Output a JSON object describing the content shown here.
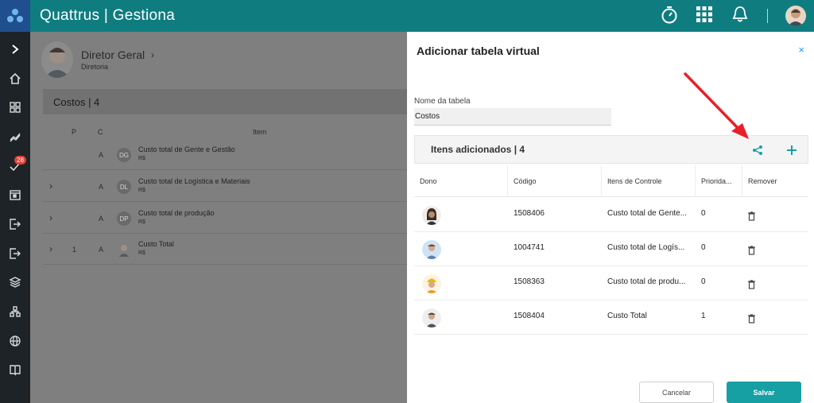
{
  "app": {
    "title": "Quattrus | Gestiona"
  },
  "topbar": {
    "icons": [
      "timer-icon",
      "apps-grid-icon",
      "bell-icon",
      "user-avatar"
    ]
  },
  "rail": {
    "items": [
      "chevron-right-icon",
      "home-icon",
      "dashboard-icon",
      "trend-icon",
      "tasks-icon",
      "calendar-icon",
      "exit-icon",
      "logout-icon",
      "layers-icon",
      "org-chart-icon",
      "globe-icon",
      "book-icon"
    ],
    "badge": "28"
  },
  "background_page": {
    "profile_name": "Diretor Geral",
    "profile_role": "Diretoria",
    "section_title": "Costos | 4",
    "columns": {
      "p": "P",
      "c": "C",
      "item": "Item"
    },
    "rows": [
      {
        "expand": "",
        "p": "",
        "c": "A",
        "initials": "DG",
        "item": "Custo total de Gente e Gestão",
        "unit": "R$"
      },
      {
        "expand": "›",
        "p": "",
        "c": "A",
        "initials": "DL",
        "item": "Custo total de Logística e Materiais",
        "unit": "R$"
      },
      {
        "expand": "›",
        "p": "",
        "c": "A",
        "initials": "DP",
        "item": "Custo total de produção",
        "unit": "R$"
      },
      {
        "expand": "›",
        "p": "1",
        "c": "A",
        "initials": "",
        "item": "Custo Total",
        "unit": "R$"
      }
    ]
  },
  "panel": {
    "title": "Adicionar tabela virtual",
    "close": "×",
    "name_label": "Nome da tabela",
    "name_value": "Costos",
    "items_title": "Itens adicionados | 4",
    "table_headers": {
      "owner": "Dono",
      "code": "Código",
      "control": "Itens de Controle",
      "priority": "Priorida...",
      "remove": "Remover"
    },
    "rows": [
      {
        "code": "1508406",
        "control": "Custo total de Gente...",
        "priority": "0"
      },
      {
        "code": "1004741",
        "control": "Custo total de Logís...",
        "priority": "0"
      },
      {
        "code": "1508363",
        "control": "Custo total de produ...",
        "priority": "0"
      },
      {
        "code": "1508404",
        "control": "Custo Total",
        "priority": "1"
      }
    ],
    "cancel_label": "Cancelar",
    "save_label": "Salvar"
  },
  "colors": {
    "topbar": "#0f7d80",
    "accent": "#16a0a4",
    "rail": "#1d2326",
    "arrow": "#e8202a",
    "close": "#2196f3"
  }
}
